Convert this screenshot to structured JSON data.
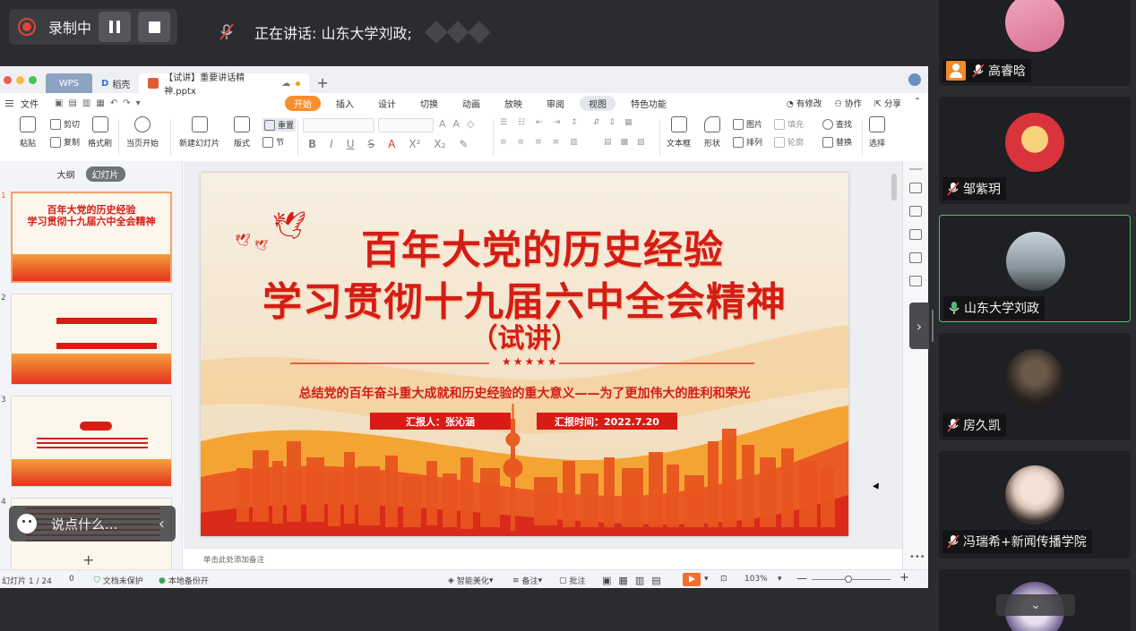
{
  "recording": {
    "label": "录制中"
  },
  "speaking": {
    "label": "正在讲话: 山东大学刘政;"
  },
  "wps": {
    "tabs": [
      {
        "label": "WPS"
      },
      {
        "label": "稻壳"
      },
      {
        "label": "【试讲】重要讲话精神.pptx"
      }
    ],
    "menu": {
      "file": "文件",
      "items": [
        "开始",
        "插入",
        "设计",
        "切换",
        "动画",
        "放映",
        "审阅",
        "视图",
        "特色功能"
      ],
      "right": [
        "有修改",
        "协作",
        "分享"
      ]
    },
    "ribbon": {
      "paste": "粘贴",
      "cut": "剪切",
      "copy": "复制",
      "format_painter": "格式刷",
      "play_from_current": "当页开始",
      "new_slide": "新建幻灯片",
      "layout": "版式",
      "section": "节",
      "reset": "重置",
      "textbox": "文本框",
      "shape": "形状",
      "picture": "图片",
      "arrange": "排列",
      "fill": "填充",
      "outline": "轮廓",
      "find": "查找",
      "replace": "替换",
      "select": "选择"
    },
    "left_panel": {
      "tab_outline": "大纲",
      "tab_slides": "幻灯片",
      "slide_numbers": [
        "1",
        "2",
        "3",
        "4"
      ]
    },
    "notes_placeholder": "单击此处添加备注",
    "status": {
      "slide_count": "幻灯片 1 / 24",
      "zero": "0",
      "doc_unprotected": "文档未保护",
      "local_backup": "本地备份开",
      "smart_beautify": "智能美化",
      "notes": "备注",
      "comments": "批注",
      "zoom": "103%"
    }
  },
  "slide": {
    "title_line1": "百年大党的历史经验",
    "title_line2": "学习贯彻十九届六中全会精神",
    "title_line3": "（试讲）",
    "stars": "★★★★★",
    "subtitle": "总结党的百年奋斗重大成就和历史经验的重大意义——为了更加伟大的胜利和荣光",
    "reporter": "汇报人：张沁涵",
    "report_time": "汇报时间：2022.7.20"
  },
  "chat": {
    "placeholder": "说点什么..."
  },
  "participants": [
    {
      "name": "高睿晗"
    },
    {
      "name": "邹紫玥"
    },
    {
      "name": "山东大学刘政"
    },
    {
      "name": "房久凯"
    },
    {
      "name": "冯瑞希+新闻传播学院"
    }
  ],
  "colors": {
    "accent_orange": "#fb8d2d",
    "slide_red": "#d31d16",
    "active_speaker_green": "#4cbf6a",
    "recording_red": "#e0443a"
  }
}
